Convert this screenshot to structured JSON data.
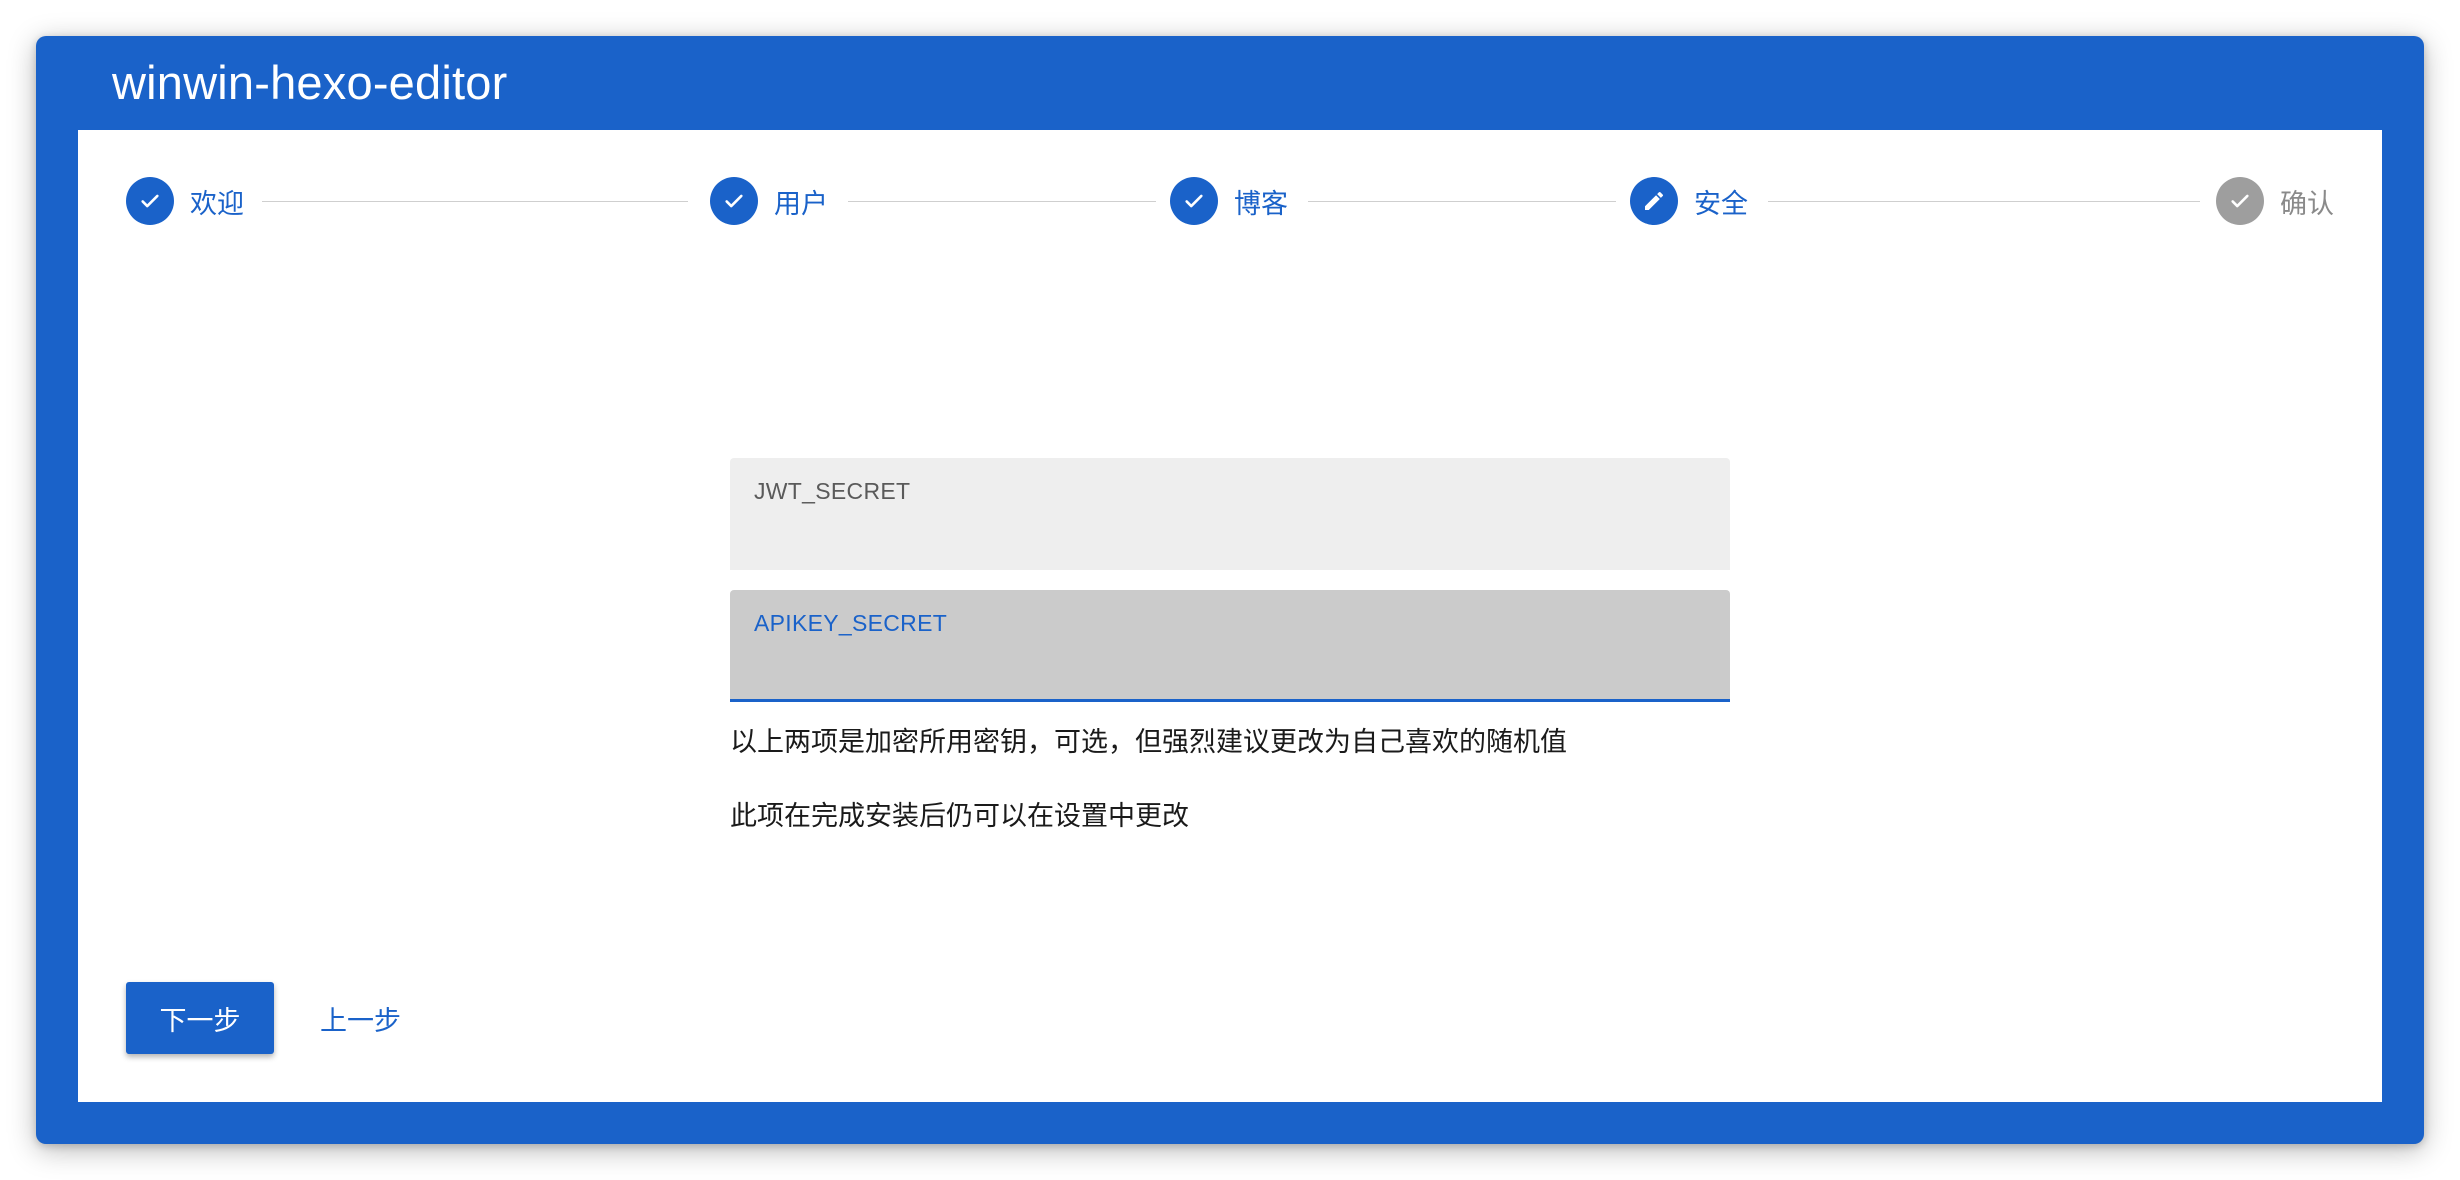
{
  "app": {
    "title": "winwin-hexo-editor"
  },
  "stepper": {
    "steps": [
      {
        "label": "欢迎",
        "state": "complete",
        "icon": "check-icon"
      },
      {
        "label": "用户",
        "state": "complete",
        "icon": "check-icon"
      },
      {
        "label": "博客",
        "state": "complete",
        "icon": "check-icon"
      },
      {
        "label": "安全",
        "state": "active",
        "icon": "pencil-icon"
      },
      {
        "label": "确认",
        "state": "pending",
        "icon": "check-icon"
      }
    ]
  },
  "form": {
    "jwt_label": "JWT_SECRET",
    "jwt_value": "",
    "apikey_label": "APIKEY_SECRET",
    "apikey_value": "",
    "hint_1": "以上两项是加密所用密钥，可选，但强烈建议更改为自己喜欢的随机值",
    "hint_2": "此项在完成安装后仍可以在设置中更改"
  },
  "actions": {
    "next_label": "下一步",
    "prev_label": "上一步"
  },
  "colors": {
    "primary": "#1a62c9",
    "pending": "#9e9e9e",
    "field_bg": "#eeeeee",
    "field_focus_bg": "#cbcbcb"
  }
}
